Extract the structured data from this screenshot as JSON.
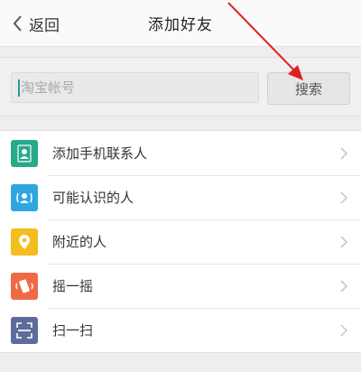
{
  "header": {
    "back_label": "返回",
    "title": "添加好友"
  },
  "search": {
    "placeholder": "淘宝帐号",
    "button_label": "搜索"
  },
  "menu": {
    "items": [
      {
        "label": "添加手机联系人",
        "icon": "contact-person-icon",
        "color": "#27a98c"
      },
      {
        "label": "可能认识的人",
        "icon": "people-radar-icon",
        "color": "#2ea7e0"
      },
      {
        "label": "附近的人",
        "icon": "location-pin-icon",
        "color": "#f3be1e"
      },
      {
        "label": "摇一摇",
        "icon": "shake-phone-icon",
        "color": "#ee6a45"
      },
      {
        "label": "扫一扫",
        "icon": "scan-frame-icon",
        "color": "#5f6b9a"
      }
    ]
  },
  "colors": {
    "annotation_arrow": "#e02020"
  }
}
